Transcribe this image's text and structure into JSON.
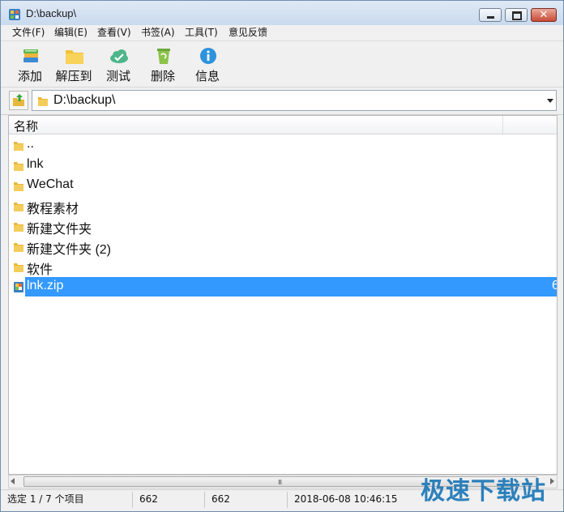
{
  "window": {
    "title": "D:\\backup\\",
    "controls": {
      "close_glyph": "✕"
    }
  },
  "menu": [
    "文件(F)",
    "编辑(E)",
    "查看(V)",
    "书签(A)",
    "工具(T)",
    "意见反馈"
  ],
  "toolbar": [
    {
      "label": "添加",
      "icon": "books-add-icon"
    },
    {
      "label": "解压到",
      "icon": "folder-extract-icon"
    },
    {
      "label": "测试",
      "icon": "cloud-check-icon"
    },
    {
      "label": "删除",
      "icon": "recycle-bin-icon"
    },
    {
      "label": "信息",
      "icon": "info-icon"
    }
  ],
  "address": {
    "path": "D:\\backup\\"
  },
  "list": {
    "column_header": "名称",
    "items": [
      {
        "name": "..",
        "type": "folder"
      },
      {
        "name": "lnk",
        "type": "folder"
      },
      {
        "name": "WeChat",
        "type": "folder"
      },
      {
        "name": "教程素材",
        "type": "folder"
      },
      {
        "name": "新建文件夹",
        "type": "folder"
      },
      {
        "name": "新建文件夹 (2)",
        "type": "folder"
      },
      {
        "name": "软件",
        "type": "folder"
      },
      {
        "name": "lnk.zip",
        "type": "archive",
        "selected": true,
        "size_fragment": "6"
      }
    ]
  },
  "scrollbar": {
    "grip": "III"
  },
  "status": {
    "selection": "选定 1 / 7 个项目",
    "size": "662",
    "packed": "662",
    "modified": "2018-06-08 10:46:15"
  },
  "watermark": "极速下载站",
  "colors": {
    "selection": "#3399ff",
    "folder": "#e8b83a",
    "accent": "#1c78b8"
  }
}
